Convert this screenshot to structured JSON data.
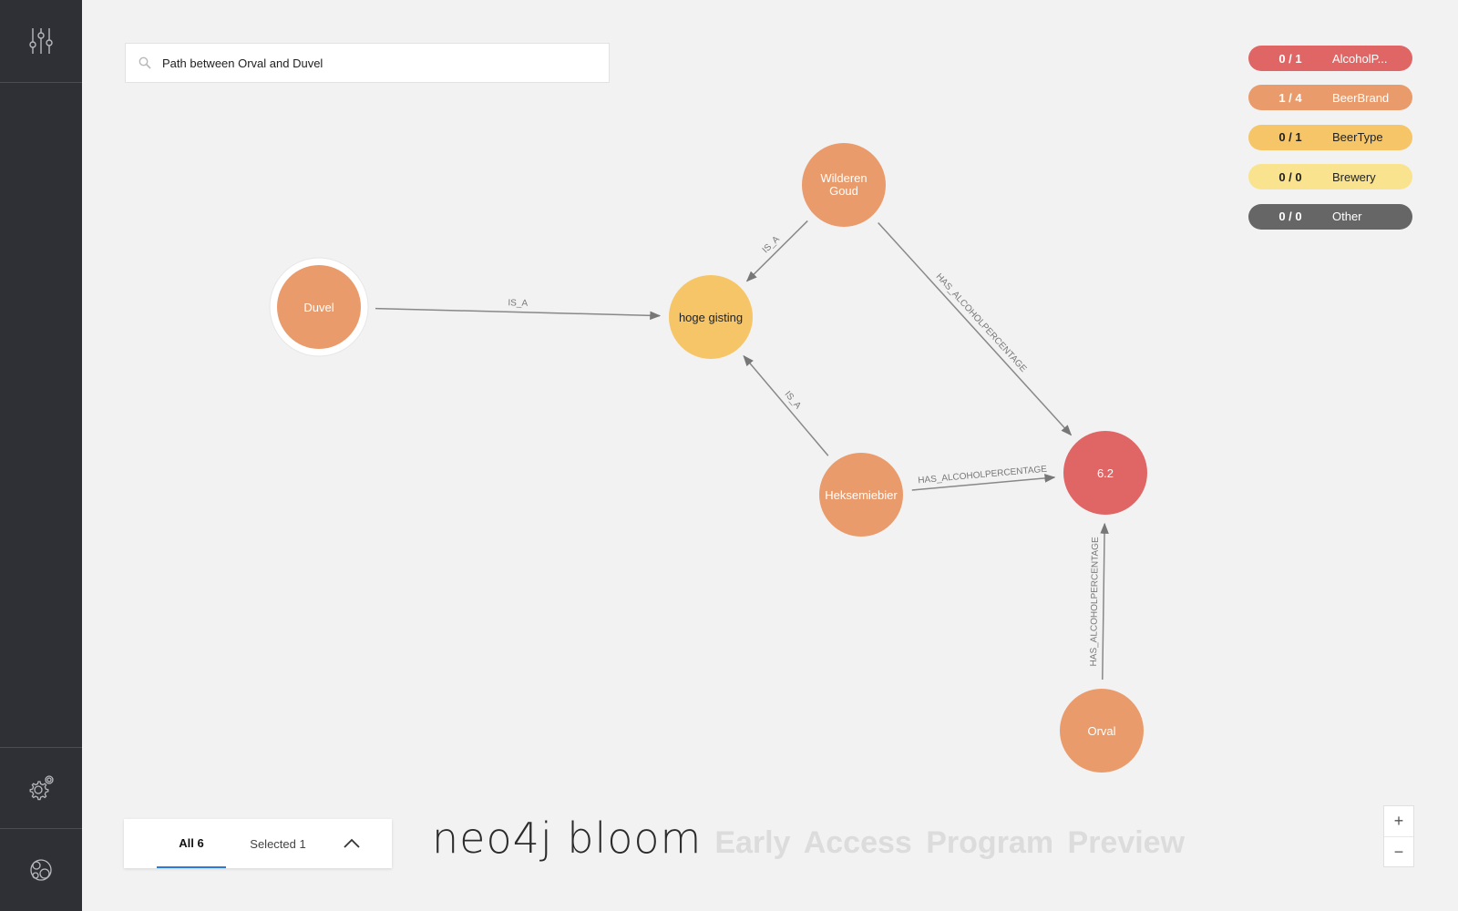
{
  "search": {
    "value": "Path between Orval and Duvel",
    "icon": "search-icon"
  },
  "legend": [
    {
      "count": "0 / 1",
      "name": "AlcoholP...",
      "color": "#e06666"
    },
    {
      "count": "1 / 4",
      "name": "BeerBrand",
      "color": "#ea9b6b"
    },
    {
      "count": "0 / 1",
      "name": "BeerType",
      "color": "#f6c567"
    },
    {
      "count": "0 / 0",
      "name": "Brewery",
      "color": "#f9e38e"
    },
    {
      "count": "0 / 0",
      "name": "Other",
      "color": "#666666"
    }
  ],
  "graph": {
    "nodes": [
      {
        "id": "duvel",
        "label": "Duvel",
        "category": "BeerBrand",
        "selected": true
      },
      {
        "id": "hoge",
        "label": "hoge gisting",
        "category": "BeerType"
      },
      {
        "id": "wilderen",
        "label": "Wilderen Goud",
        "category": "BeerBrand"
      },
      {
        "id": "hekse",
        "label": "Heksemiebier",
        "category": "BeerBrand"
      },
      {
        "id": "p62",
        "label": "6.2",
        "category": "AlcoholPercentage"
      },
      {
        "id": "orval",
        "label": "Orval",
        "category": "BeerBrand"
      }
    ],
    "edges": [
      {
        "from": "duvel",
        "to": "hoge",
        "label": "IS_A"
      },
      {
        "from": "wilderen",
        "to": "hoge",
        "label": "IS_A"
      },
      {
        "from": "hekse",
        "to": "hoge",
        "label": "IS_A"
      },
      {
        "from": "wilderen",
        "to": "p62",
        "label": "HAS_ALCOHOLPERCENTAGE"
      },
      {
        "from": "hekse",
        "to": "p62",
        "label": "HAS_ALCOHOLPERCENTAGE"
      },
      {
        "from": "orval",
        "to": "p62",
        "label": "HAS_ALCOHOLPERCENTAGE"
      }
    ]
  },
  "tabs": {
    "all": "All 6",
    "selected": "Selected 1"
  },
  "brand": {
    "logo": "neo4j bloom",
    "subtitle": "Early Access Program Preview"
  },
  "zoom": {
    "in": "+",
    "out": "−"
  },
  "colors": {
    "sidebar": "#2e3035",
    "background": "#f2f2f2",
    "edge": "#888888",
    "tab_accent": "#2a7bd6"
  },
  "sidebar": {
    "top_icon": "sliders-icon",
    "settings_icon": "gear-settings-icon",
    "bottom_icon": "bloom-logo-icon"
  }
}
